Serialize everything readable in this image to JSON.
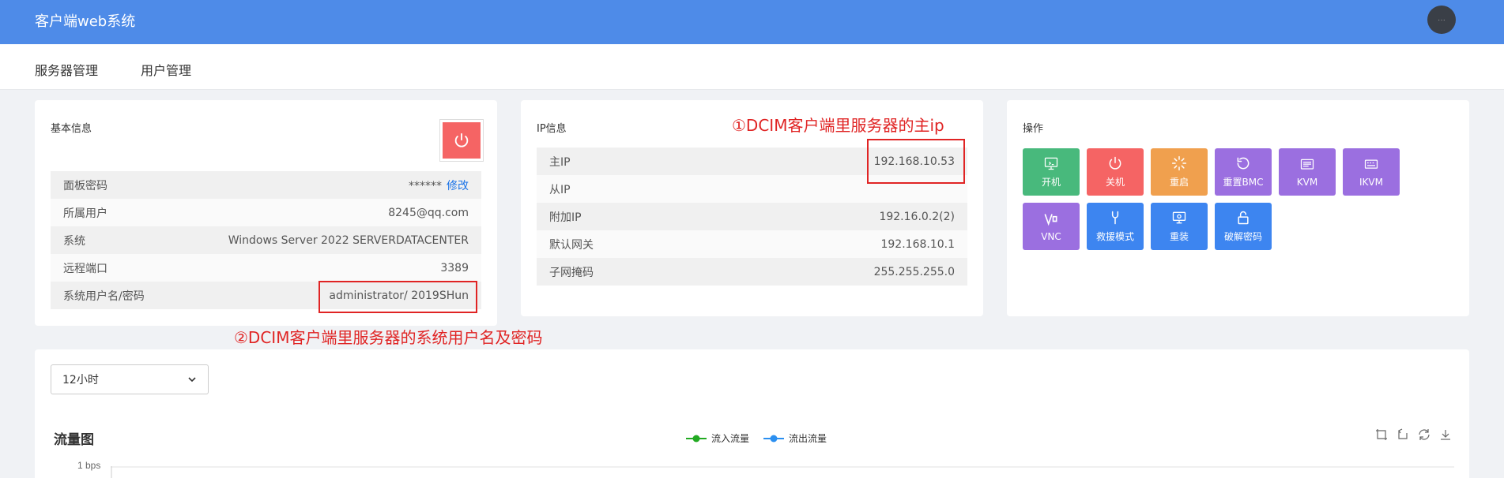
{
  "header": {
    "title": "客户端web系统"
  },
  "nav": {
    "items": [
      "服务器管理",
      "用户管理"
    ]
  },
  "basic_info": {
    "title": "基本信息",
    "rows": [
      {
        "label": "面板密码",
        "value": "******",
        "link": "修改"
      },
      {
        "label": "所属用户",
        "value": "8245@qq.com"
      },
      {
        "label": "系统",
        "value": "Windows Server 2022 SERVERDATACENTER"
      },
      {
        "label": "远程端口",
        "value": "3389"
      },
      {
        "label": "系统用户名/密码",
        "value": "administrator/ 2019SHun"
      }
    ],
    "power_icon": "power-icon"
  },
  "ip_info": {
    "title": "IP信息",
    "rows": [
      {
        "label": "主IP",
        "value": "192.168.10.53"
      },
      {
        "label": "从IP",
        "value": ""
      },
      {
        "label": "附加IP",
        "value": "192.16.0.2(2)"
      },
      {
        "label": "默认网关",
        "value": "192.168.10.1"
      },
      {
        "label": "子网掩码",
        "value": "255.255.255.0"
      }
    ]
  },
  "operations": {
    "title": "操作",
    "buttons": [
      {
        "label": "开机",
        "color": "#48b97c",
        "icon": "monitor-icon"
      },
      {
        "label": "关机",
        "color": "#f56464",
        "icon": "power-icon"
      },
      {
        "label": "重启",
        "color": "#f0a04e",
        "icon": "loading-icon"
      },
      {
        "label": "重置BMC",
        "color": "#9b6fe0",
        "icon": "reset-icon"
      },
      {
        "label": "KVM",
        "color": "#9b6fe0",
        "icon": "kvm-icon"
      },
      {
        "label": "IKVM",
        "color": "#9b6fe0",
        "icon": "ikvm-icon"
      },
      {
        "label": "VNC",
        "color": "#9b6fe0",
        "icon": "vnc-icon"
      },
      {
        "label": "救援模式",
        "color": "#3d85f0",
        "icon": "wrench-icon"
      },
      {
        "label": "重装",
        "color": "#3d85f0",
        "icon": "reinstall-icon"
      },
      {
        "label": "破解密码",
        "color": "#3d85f0",
        "icon": "unlock-icon"
      }
    ]
  },
  "annotations": {
    "ip": "①DCIM客户端里服务器的主ip",
    "credentials": "②DCIM客户端里服务器的系统用户名及密码"
  },
  "traffic": {
    "range_select": "12小时",
    "title": "流量图",
    "legend": [
      {
        "name": "流入流量",
        "color": "#22aa22"
      },
      {
        "name": "流出流量",
        "color": "#2b8ff0"
      }
    ],
    "ytick_top": "1 bps",
    "tools": [
      "zoom-icon",
      "zoom-reset-icon",
      "refresh-icon",
      "download-icon"
    ]
  }
}
